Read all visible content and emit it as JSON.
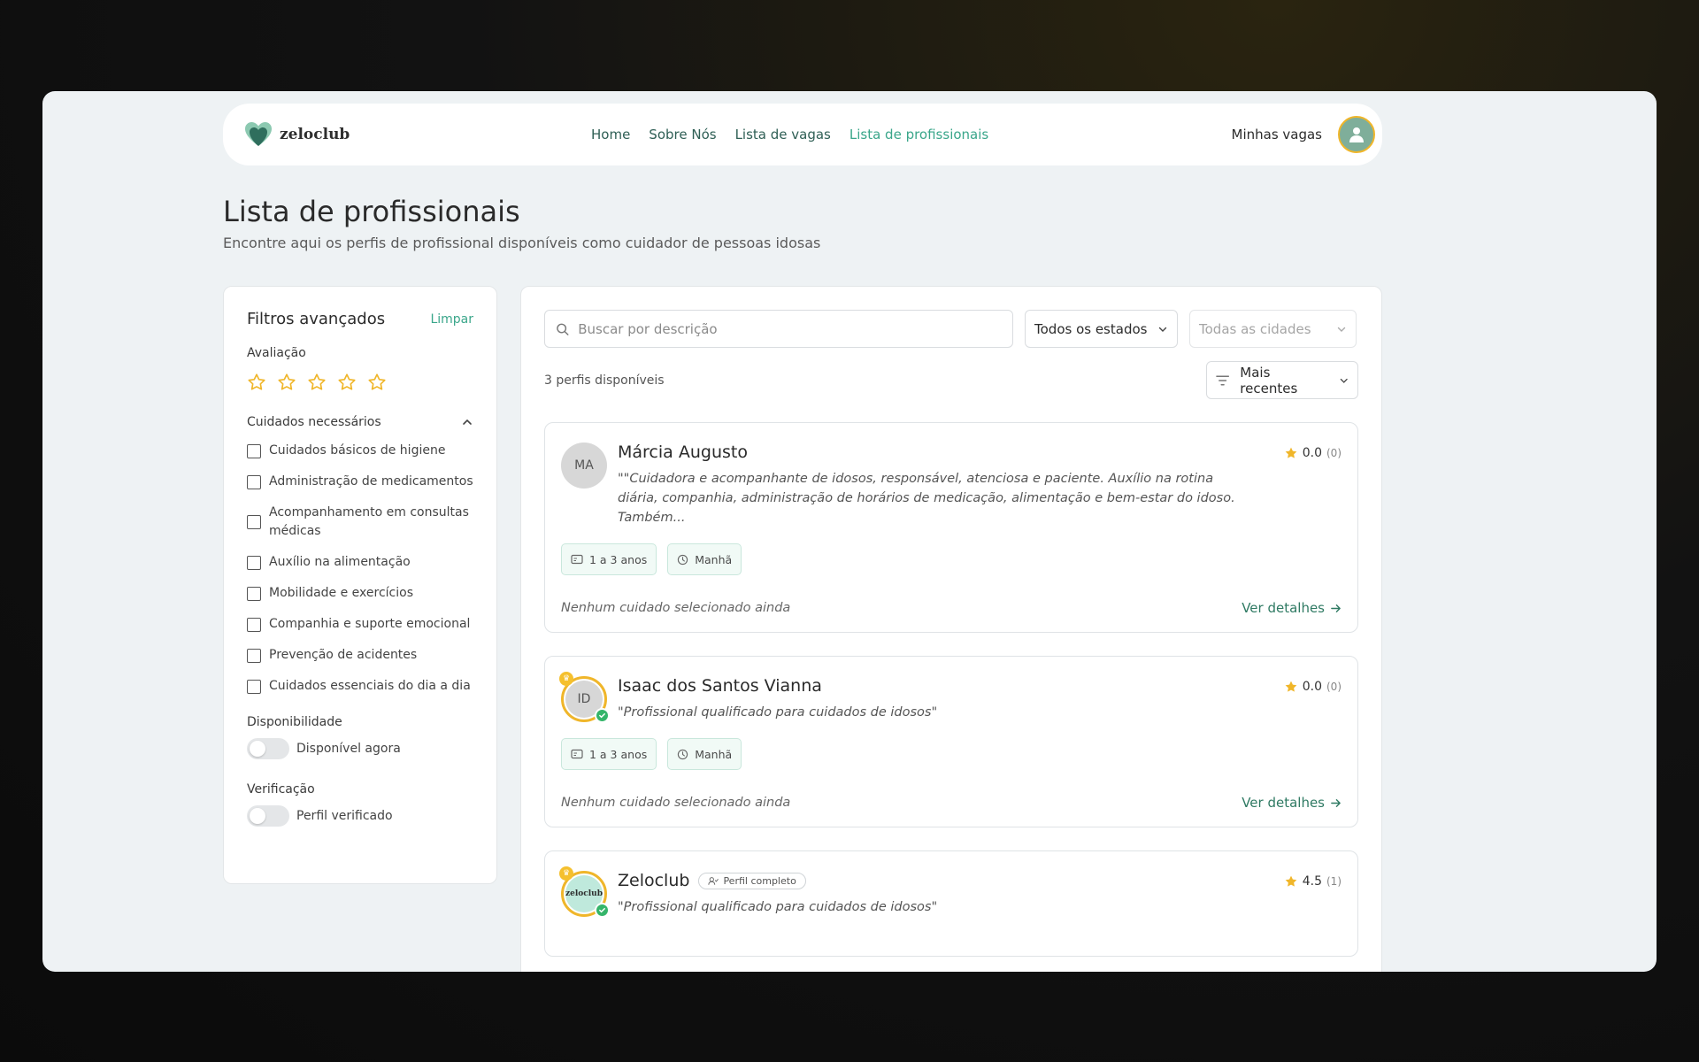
{
  "nav": {
    "brand": "zeloclub",
    "links": [
      "Home",
      "Sobre Nós",
      "Lista de vagas",
      "Lista de profissionais"
    ],
    "active_link": "Lista de profissionais",
    "right_link": "Minhas vagas"
  },
  "header": {
    "title": "Lista de profissionais",
    "subtitle": "Encontre aqui os perfis de profissional disponíveis como cuidador de pessoas idosas"
  },
  "sidebar": {
    "title": "Filtros avançados",
    "clear_label": "Limpar",
    "rating_label": "Avaliação",
    "rating_selected": 0,
    "care_label": "Cuidados necessários",
    "care_items": [
      "Cuidados básicos de higiene",
      "Administração de medicamentos",
      "Acompanhamento em consultas médicas",
      "Auxílio na alimentação",
      "Mobilidade e exercícios",
      "Companhia e suporte emocional",
      "Prevenção de acidentes",
      "Cuidados essenciais do dia a dia"
    ],
    "availability_label": "Disponibilidade",
    "availability_toggle": "Disponível agora",
    "verification_label": "Verificação",
    "verification_toggle": "Perfil verificado"
  },
  "main": {
    "search_placeholder": "Buscar por descrição",
    "state_select": "Todos os estados",
    "city_select": "Todas as cidades",
    "count_text": "3 perfis disponíveis",
    "sort_select": "Mais recentes",
    "cards": [
      {
        "initials": "MA",
        "name": "Márcia Augusto",
        "description": "\"\"Cuidadora e acompanhante de idosos, responsável, atenciosa e paciente. Auxílio na rotina diária, companhia, administração de horários de medicação, alimentação e bem-estar do idoso. Também...",
        "rating": "0.0",
        "rating_count": "(0)",
        "experience": "1 a 3 anos",
        "shift": "Manhã",
        "care_text": "Nenhum cuidado selecionado ainda",
        "details_label": "Ver detalhes"
      },
      {
        "initials": "ID",
        "name": "Isaac dos Santos Vianna",
        "description": "\"Profissional qualificado para cuidados de idosos\"",
        "rating": "0.0",
        "rating_count": "(0)",
        "experience": "1 a 3 anos",
        "shift": "Manhã",
        "care_text": "Nenhum cuidado selecionado ainda",
        "details_label": "Ver detalhes"
      },
      {
        "initials": "zeloclub",
        "name": "Zeloclub",
        "badge": "Perfil completo",
        "description": "\"Profissional qualificado para cuidados de idosos\"",
        "rating": "4.5",
        "rating_count": "(1)"
      }
    ]
  },
  "colors": {
    "accent": "#3aa68a",
    "star": "#f0b62a",
    "verified": "#35b56a"
  }
}
